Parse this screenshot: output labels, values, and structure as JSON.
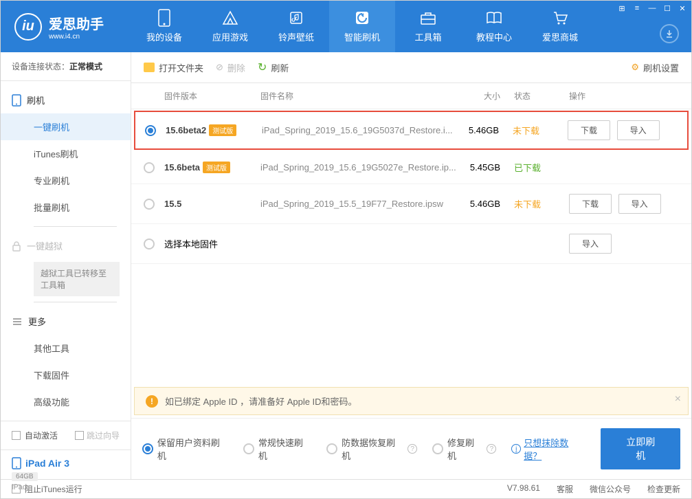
{
  "logo": {
    "name": "爱思助手",
    "url": "www.i4.cn"
  },
  "nav": [
    {
      "label": "我的设备"
    },
    {
      "label": "应用游戏"
    },
    {
      "label": "铃声壁纸"
    },
    {
      "label": "智能刷机"
    },
    {
      "label": "工具箱"
    },
    {
      "label": "教程中心"
    },
    {
      "label": "爱思商城"
    }
  ],
  "sidebar": {
    "status_label": "设备连接状态：",
    "status_value": "正常模式",
    "flash_group": "刷机",
    "items": [
      "一键刷机",
      "iTunes刷机",
      "专业刷机",
      "批量刷机"
    ],
    "jailbreak_group": "一键越狱",
    "jailbreak_note": "越狱工具已转移至工具箱",
    "more_group": "更多",
    "more_items": [
      "其他工具",
      "下载固件",
      "高级功能"
    ],
    "auto_activate": "自动激活",
    "skip_guide": "跳过向导",
    "device": {
      "name": "iPad Air 3",
      "storage": "64GB",
      "type": "iPad"
    }
  },
  "toolbar": {
    "open_folder": "打开文件夹",
    "delete": "删除",
    "refresh": "刷新",
    "settings": "刷机设置"
  },
  "table": {
    "headers": {
      "version": "固件版本",
      "name": "固件名称",
      "size": "大小",
      "status": "状态",
      "action": "操作"
    },
    "rows": [
      {
        "version": "15.6beta2",
        "beta": "测试版",
        "name": "iPad_Spring_2019_15.6_19G5037d_Restore.i...",
        "size": "5.46GB",
        "status": "未下载",
        "status_class": "not",
        "selected": true,
        "highlight": true,
        "actions": [
          "下载",
          "导入"
        ]
      },
      {
        "version": "15.6beta",
        "beta": "测试版",
        "name": "iPad_Spring_2019_15.6_19G5027e_Restore.ip...",
        "size": "5.45GB",
        "status": "已下载",
        "status_class": "done",
        "selected": false,
        "actions": []
      },
      {
        "version": "15.5",
        "beta": "",
        "name": "iPad_Spring_2019_15.5_19F77_Restore.ipsw",
        "size": "5.46GB",
        "status": "未下载",
        "status_class": "not",
        "selected": false,
        "actions": [
          "下载",
          "导入"
        ]
      },
      {
        "version": "",
        "local_label": "选择本地固件",
        "name": "",
        "size": "",
        "status": "",
        "selected": false,
        "actions": [
          "导入"
        ]
      }
    ]
  },
  "warning": "如已绑定 Apple ID ，请准备好 Apple ID和密码。",
  "flash_options": {
    "opts": [
      "保留用户资料刷机",
      "常规快速刷机",
      "防数据恢复刷机",
      "修复刷机"
    ],
    "erase_link": "只想抹除数据？",
    "button": "立即刷机"
  },
  "statusbar": {
    "block_itunes": "阻止iTunes运行",
    "version": "V7.98.61",
    "links": [
      "客服",
      "微信公众号",
      "检查更新"
    ]
  }
}
